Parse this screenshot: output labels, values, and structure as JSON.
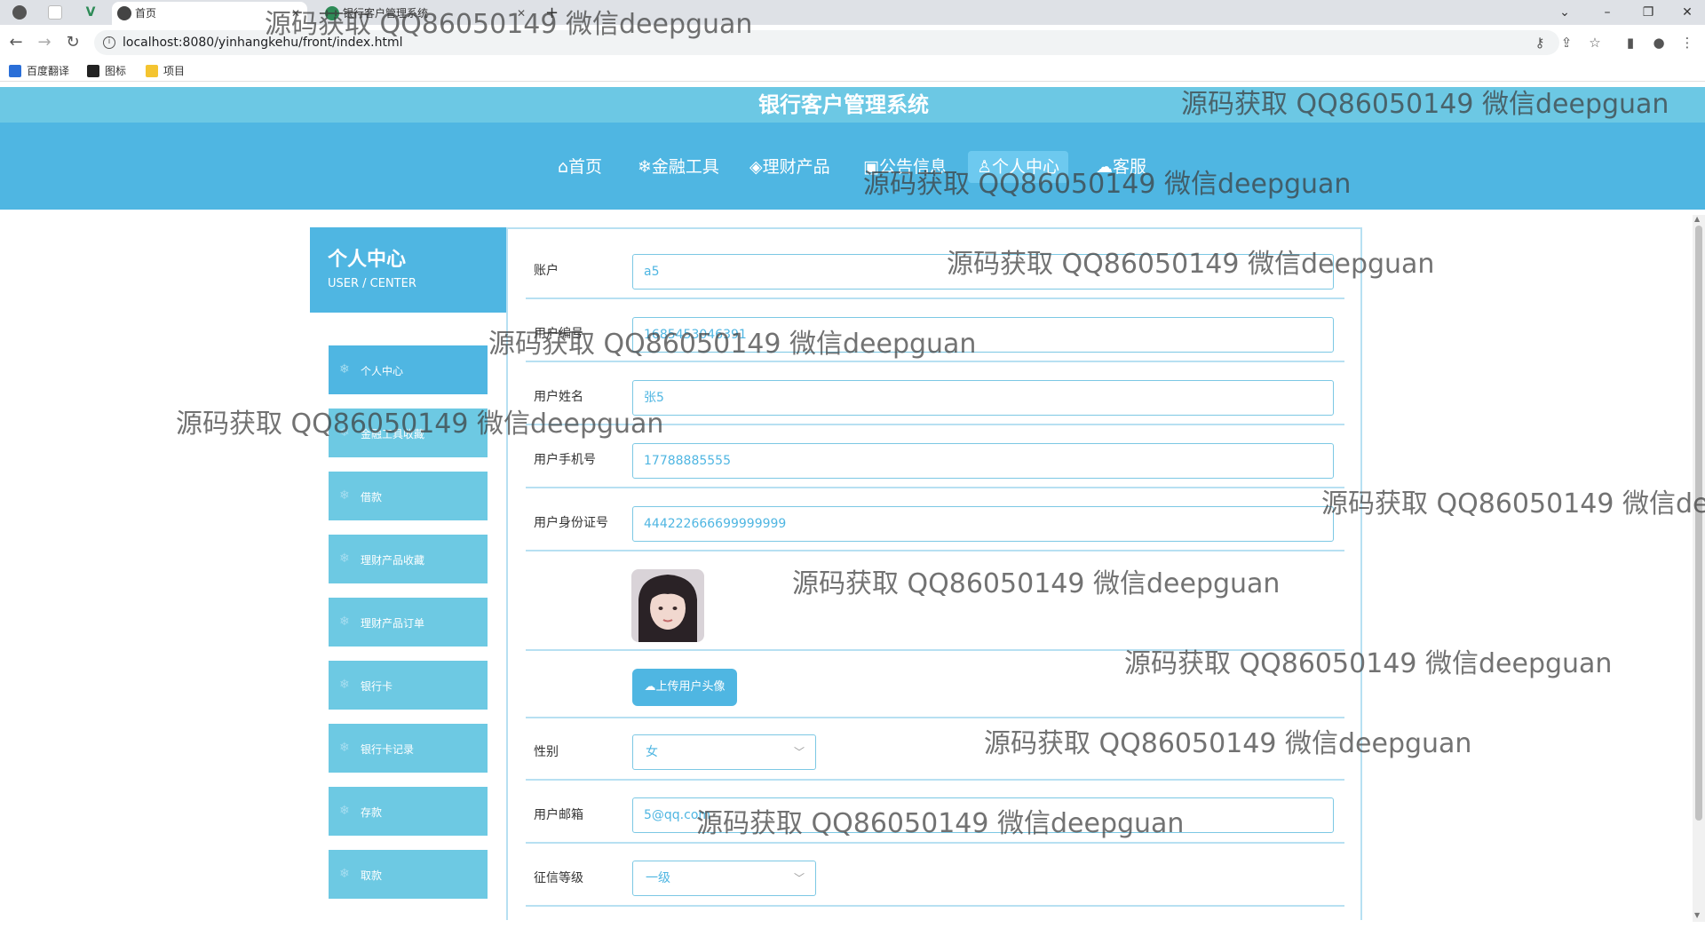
{
  "browser": {
    "tabs": [
      {
        "title": "首页",
        "active": true
      },
      {
        "title": "银行客户管理系统",
        "active": false
      }
    ],
    "new_tab": "+",
    "url": "localhost:8080/yinhangkehu/front/index.html",
    "bookmarks": [
      "百度翻译",
      "图标",
      "项目"
    ]
  },
  "site": {
    "title": "银行客户管理系统",
    "nav": [
      {
        "label": "⌂首页",
        "active": false
      },
      {
        "label": "❄金融工具",
        "active": false
      },
      {
        "label": "◈理财产品",
        "active": false
      },
      {
        "label": "▣公告信息",
        "active": false
      },
      {
        "label": "♙个人中心",
        "active": true
      },
      {
        "label": "☁客服",
        "active": false
      }
    ]
  },
  "sidebar": {
    "title": "个人中心",
    "subtitle": "USER / CENTER",
    "items": [
      {
        "label": "个人中心",
        "active": true
      },
      {
        "label": "金融工具收藏",
        "active": false
      },
      {
        "label": "借款",
        "active": false
      },
      {
        "label": "理财产品收藏",
        "active": false
      },
      {
        "label": "理财产品订单",
        "active": false
      },
      {
        "label": "银行卡",
        "active": false
      },
      {
        "label": "银行卡记录",
        "active": false
      },
      {
        "label": "存款",
        "active": false
      },
      {
        "label": "取款",
        "active": false
      }
    ]
  },
  "form": {
    "account_label": "账户",
    "account_value": "a5",
    "code_label": "用户编号",
    "code_value": "1685453046391",
    "name_label": "用户姓名",
    "name_value": "张5",
    "phone_label": "用户手机号",
    "phone_value": "17788885555",
    "idcard_label": "用户身份证号",
    "idcard_value": "444222666699999999",
    "upload_label": "☁上传用户头像",
    "gender_label": "性别",
    "gender_value": "女",
    "email_label": "用户邮箱",
    "email_value": "5@qq.com",
    "credit_label": "征信等级",
    "credit_value": "一级"
  },
  "watermark": "源码获取 QQ86050149 微信deepguan",
  "colors": {
    "primary": "#4fb6e2",
    "light": "#6cc8e4",
    "border": "#b7e0f2"
  }
}
